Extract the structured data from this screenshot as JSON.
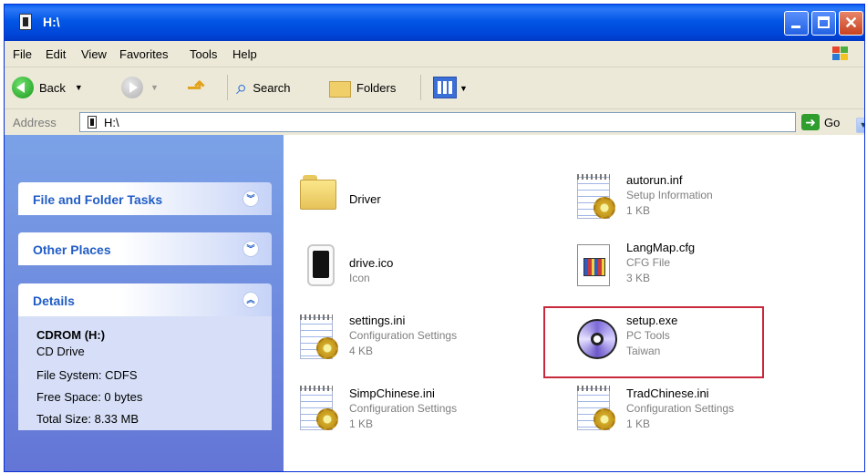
{
  "window": {
    "title": "H:\\"
  },
  "menu": [
    "File",
    "Edit",
    "View",
    "Favorites",
    "Tools",
    "Help"
  ],
  "toolbar": {
    "back_label": "Back",
    "search_label": "Search",
    "folders_label": "Folders"
  },
  "address": {
    "label": "Address",
    "value": "H:\\",
    "go_label": "Go"
  },
  "tasks": {
    "file_folder_tasks": "File and Folder Tasks",
    "other_places": "Other Places",
    "details": "Details",
    "details_lines": [
      "CDROM (H:)",
      "CD Drive",
      "File System: CDFS",
      "Free Space: 0 bytes",
      "Total Size: 8.33 MB"
    ]
  },
  "files": [
    {
      "name": "Driver",
      "type": "",
      "size": "",
      "icon": "folder-icon"
    },
    {
      "name": "autorun.inf",
      "type": "Setup Information",
      "size": "1 KB",
      "icon": "setup-info-icon"
    },
    {
      "name": "drive.ico",
      "type": "Icon",
      "size": "",
      "icon": "device-icon"
    },
    {
      "name": "LangMap.cfg",
      "type": "CFG File",
      "size": "3 KB",
      "icon": "cfg-file-icon"
    },
    {
      "name": "settings.ini",
      "type": "Configuration Settings",
      "size": "4 KB",
      "icon": "config-settings-icon"
    },
    {
      "name": "setup.exe",
      "type": "PC Tools",
      "size": "Taiwan",
      "icon": "cd-disc-icon"
    },
    {
      "name": "SimpChinese.ini",
      "type": "Configuration Settings",
      "size": "1 KB",
      "icon": "config-settings-icon"
    },
    {
      "name": "TradChinese.ini",
      "type": "Configuration Settings",
      "size": "1 KB",
      "icon": "config-settings-icon"
    }
  ],
  "colors": {
    "title_blue": "#0046d8",
    "task_pane_blue": "#6375d6",
    "highlight_red": "#c8283c"
  }
}
